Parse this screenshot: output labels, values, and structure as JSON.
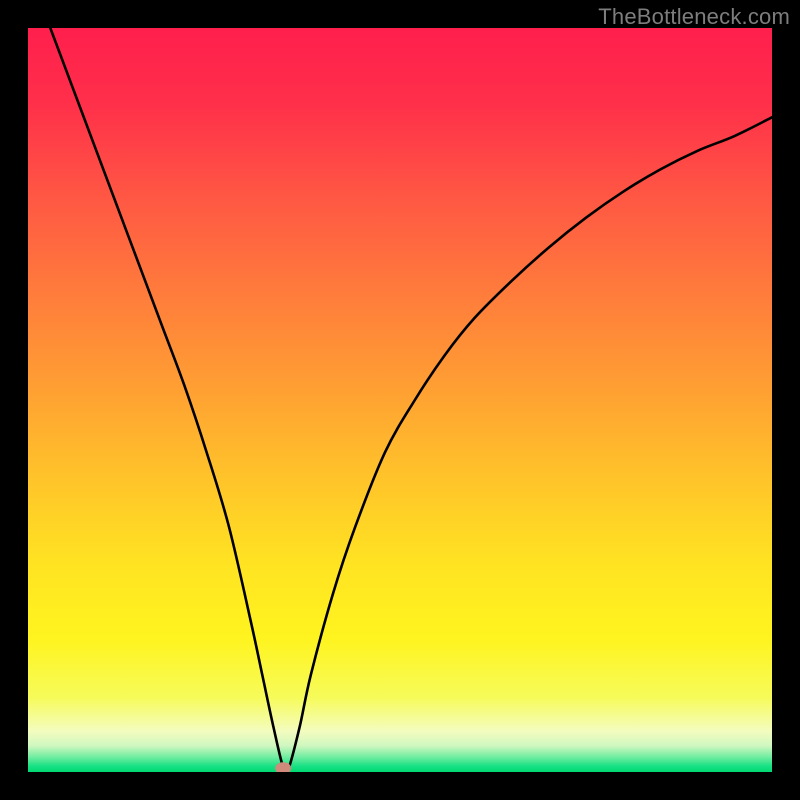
{
  "watermark": "TheBottleneck.com",
  "chart_data": {
    "type": "line",
    "title": "",
    "xlabel": "",
    "ylabel": "",
    "xlim": [
      0,
      100
    ],
    "ylim": [
      0,
      100
    ],
    "grid": false,
    "legend": false,
    "series": [
      {
        "name": "bottleneck-curve",
        "x": [
          3,
          6,
          9,
          12,
          15,
          18,
          21,
          24,
          27,
          30,
          31.5,
          33,
          34.3,
          35,
          36.5,
          38,
          41,
          44,
          48,
          52,
          56,
          60,
          65,
          70,
          75,
          80,
          85,
          90,
          95,
          100
        ],
        "y": [
          100,
          92,
          84,
          76,
          68,
          60,
          52,
          43,
          33,
          20,
          13,
          6,
          0.6,
          0.4,
          6,
          13,
          24,
          33,
          43,
          50,
          56,
          61,
          66,
          70.5,
          74.5,
          78,
          81,
          83.5,
          85.5,
          88
        ]
      }
    ],
    "marker": {
      "x": 34.3,
      "y": 0.5,
      "color": "#cf8a7b"
    },
    "gradient_stops": [
      {
        "offset": 0.0,
        "color": "#ff1f4d"
      },
      {
        "offset": 0.1,
        "color": "#ff2f4a"
      },
      {
        "offset": 0.22,
        "color": "#ff5544"
      },
      {
        "offset": 0.35,
        "color": "#ff7a3c"
      },
      {
        "offset": 0.48,
        "color": "#ff9e33"
      },
      {
        "offset": 0.6,
        "color": "#ffc22a"
      },
      {
        "offset": 0.72,
        "color": "#ffe322"
      },
      {
        "offset": 0.82,
        "color": "#fff41f"
      },
      {
        "offset": 0.9,
        "color": "#f6fb5a"
      },
      {
        "offset": 0.945,
        "color": "#f4fcbf"
      },
      {
        "offset": 0.965,
        "color": "#cef7bf"
      },
      {
        "offset": 0.98,
        "color": "#70eda0"
      },
      {
        "offset": 0.992,
        "color": "#18e184"
      },
      {
        "offset": 1.0,
        "color": "#00d973"
      }
    ]
  }
}
